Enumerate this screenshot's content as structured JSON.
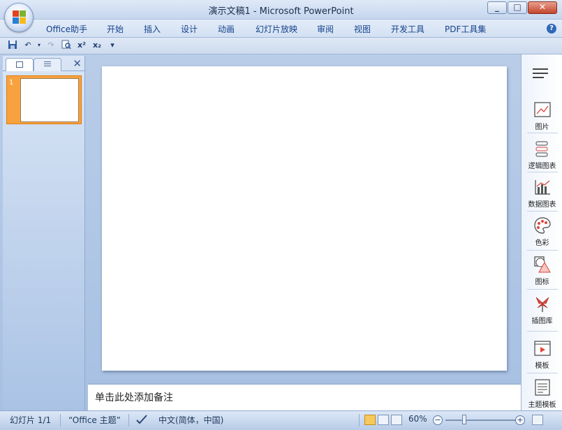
{
  "window": {
    "title": "演示文稿1 - Microsoft PowerPoint",
    "minimize_label": "_",
    "maximize_label": "□",
    "close_label": "✕"
  },
  "ribbon": {
    "tabs": [
      "Office助手",
      "开始",
      "插入",
      "设计",
      "动画",
      "幻灯片放映",
      "审阅",
      "视图",
      "开发工具",
      "PDF工具集"
    ],
    "help_label": "?"
  },
  "qat": {
    "save_icon": "floppy-icon",
    "undo_icon": "undo-icon",
    "redo_icon": "redo-icon",
    "preview_icon": "print-preview-icon",
    "superscript_label": "x²",
    "subscript_label": "x₂",
    "customize_label": "▾"
  },
  "left_panel": {
    "close_label": "✕",
    "slides": [
      {
        "number": "1"
      }
    ]
  },
  "notes": {
    "placeholder": "单击此处添加备注"
  },
  "right_sidebar": {
    "items": [
      {
        "label": "图片",
        "icon": "picture-icon"
      },
      {
        "label": "逻辑图表",
        "icon": "logic-diagram-icon"
      },
      {
        "label": "数据图表",
        "icon": "data-chart-icon"
      },
      {
        "label": "色彩",
        "icon": "palette-icon"
      },
      {
        "label": "图标",
        "icon": "shapes-icon"
      },
      {
        "label": "插图库",
        "icon": "illustration-icon"
      },
      {
        "label": "模板",
        "icon": "template-icon"
      },
      {
        "label": "主题模板",
        "icon": "theme-template-icon"
      }
    ]
  },
  "status_bar": {
    "slide_info": "幻灯片 1/1",
    "theme": "“Office 主题”",
    "language": "中文(简体，中国)",
    "zoom": "60%",
    "zoom_out": "−",
    "zoom_in": "+"
  },
  "colors": {
    "accent": "#f8a23f",
    "ribbon_text": "#15428b",
    "workspace": "#a7c0e2"
  }
}
